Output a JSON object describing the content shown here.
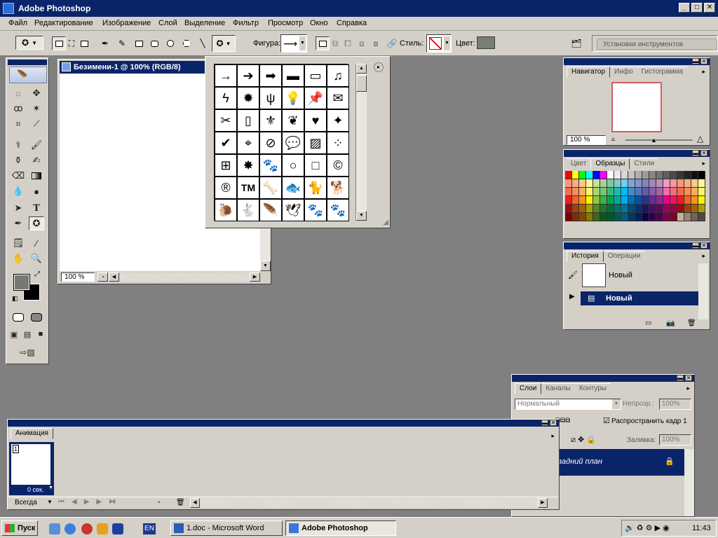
{
  "app": {
    "title": "Adobe Photoshop"
  },
  "window_buttons": {
    "minimize": "_",
    "restore": "□",
    "close": "✕"
  },
  "menu": {
    "items": [
      "Файл",
      "Редактирование",
      "Изображение",
      "Слой",
      "Выделение",
      "Фильтр",
      "Просмотр",
      "Окно",
      "Справка"
    ]
  },
  "options": {
    "shape_label": "Фигура:",
    "style_label": "Стиль:",
    "color_label": "Цвет:",
    "color_value": "#7a7c76",
    "palette_well": "Установки инструментов"
  },
  "document": {
    "title": "Безимени-1 @ 100% (RGB/8)",
    "zoom": "100 %"
  },
  "shape_picker": {
    "shapes": [
      "→",
      "➔",
      "➡",
      "▬",
      "▭",
      "♫",
      "ϟ",
      "✹",
      "ψ",
      "💡",
      "📌",
      "✉",
      "✂",
      "▯",
      "⚜",
      "❦",
      "♥",
      "✦",
      "✔",
      "⌖",
      "⊘",
      "💬",
      "▨",
      "⁘",
      "⊞",
      "✸",
      "🐾",
      "○",
      "□",
      "©",
      "®",
      "TM",
      "🦴",
      "🐟",
      "🐈",
      "🐕",
      "🐌",
      "🐇",
      "🪶",
      "🕊",
      "🐾",
      "🐾"
    ],
    "flyout": "▸"
  },
  "navigator": {
    "tabs": [
      "Навигатор",
      "Инфо",
      "Гистограмма"
    ],
    "zoom": "100 %"
  },
  "swatches": {
    "tabs": [
      "Цвет",
      "Образцы",
      "Стили"
    ],
    "colors": [
      "#ff0000",
      "#ffff00",
      "#00ff00",
      "#00ffff",
      "#0000ff",
      "#ff00ff",
      "#ffffff",
      "#ebebeb",
      "#d7d7d7",
      "#c3c3c3",
      "#afafaf",
      "#9b9b9b",
      "#878787",
      "#737373",
      "#5f5f5f",
      "#4b4b4b",
      "#373737",
      "#232323",
      "#0f0f0f",
      "#000000",
      "#f7977a",
      "#f9ad81",
      "#fdc68a",
      "#fff79a",
      "#c4df9b",
      "#a2d39c",
      "#82ca9d",
      "#7bcdc8",
      "#6ecff6",
      "#7ea7d8",
      "#8493ca",
      "#8882be",
      "#a187be",
      "#bc8dbf",
      "#f49ac2",
      "#f6989d",
      "#f7977a",
      "#f9ad81",
      "#fdc68a",
      "#fff79a",
      "#f26c4f",
      "#f68e55",
      "#fbaf5c",
      "#fff467",
      "#acd372",
      "#7cc576",
      "#3bb878",
      "#1abbb4",
      "#00bff3",
      "#438cca",
      "#5574b9",
      "#605ca8",
      "#855fa8",
      "#a763a8",
      "#f06ea9",
      "#f26d7d",
      "#f26c4f",
      "#f68e55",
      "#fbaf5c",
      "#fff467",
      "#ed1c24",
      "#f26522",
      "#f7941d",
      "#fff200",
      "#8dc63f",
      "#39b54a",
      "#00a651",
      "#00a99d",
      "#00aeef",
      "#0072bc",
      "#0054a6",
      "#2e3192",
      "#662d91",
      "#92278f",
      "#ec008c",
      "#ed145b",
      "#ed1c24",
      "#f26522",
      "#f7941d",
      "#fff200",
      "#9e0b0f",
      "#a0410d",
      "#a3620a",
      "#aba000",
      "#598527",
      "#1a7b30",
      "#007236",
      "#00746b",
      "#0076a3",
      "#004b80",
      "#003471",
      "#1b1464",
      "#440e62",
      "#630460",
      "#9e005d",
      "#9e0039",
      "#9e0b0f",
      "#a0410d",
      "#a3620a",
      "#aba000",
      "#790000",
      "#7b2e00",
      "#7d4900",
      "#827b00",
      "#406618",
      "#005e20",
      "#005826",
      "#005952",
      "#005b7f",
      "#003663",
      "#002157",
      "#0d004c",
      "#32004b",
      "#4b0049",
      "#7b0046",
      "#7a0026",
      "#c7b299",
      "#998675",
      "#736357",
      "#534741"
    ]
  },
  "history": {
    "tabs": [
      "История",
      "Операции"
    ],
    "snapshot": "Новый",
    "state": "Новый"
  },
  "layers": {
    "tabs": [
      "Слои",
      "Каналы",
      "Контуры"
    ],
    "blend_mode": "Нормальный",
    "opacity_label": "Непрозр.:",
    "opacity": "100%",
    "propagate": "Распространить кадр 1",
    "fill_label": "Заливка:",
    "fill": "100%",
    "layer_name": "задний план"
  },
  "animation": {
    "tab": "Анимация",
    "frame_number": "1",
    "frame_delay": "0 сек.",
    "loop": "Всегда"
  },
  "taskbar": {
    "start": "Пуск",
    "lang": "EN",
    "tasks": [
      "1.doc - Microsoft Word",
      "Adobe Photoshop"
    ],
    "clock": "11:43"
  }
}
